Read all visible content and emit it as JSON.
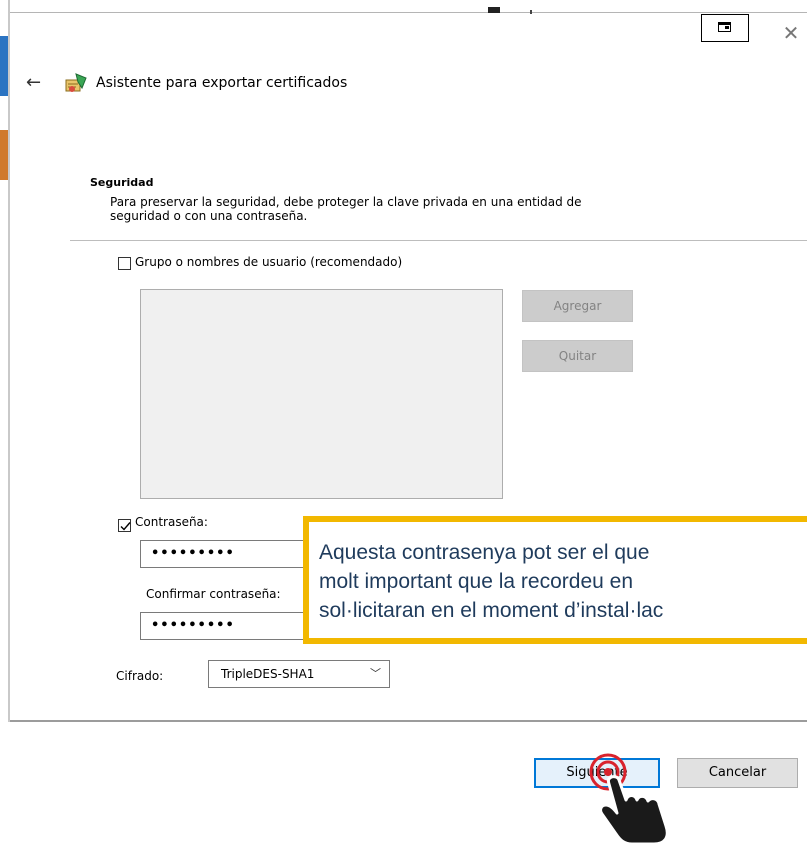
{
  "window": {
    "title": "Asistente para exportar certificados"
  },
  "security": {
    "section_title": "Seguridad",
    "description_line1": "Para preservar la seguridad, debe proteger la clave privada en una entidad de",
    "description_line2": "seguridad o con una contraseña.",
    "group_checkbox_label": "Grupo o nombres de usuario (recomendado)",
    "group_checked": false,
    "add_button": "Agregar",
    "remove_button": "Quitar",
    "password_checkbox_label": "Contraseña:",
    "password_checked": true,
    "password_value": "•••••••••",
    "confirm_label": "Confirmar contraseña:",
    "confirm_value": "•••••••••",
    "encryption_label": "Cifrado:",
    "encryption_value": "TripleDES-SHA1"
  },
  "footer": {
    "next_button": "Siguiente",
    "cancel_button": "Cancelar"
  },
  "callout": {
    "line1": "Aquesta contrasenya pot ser el que",
    "line2": "molt important que la recordeu en",
    "line3": "sol·licitaran en el moment d’instal·lac"
  },
  "colors": {
    "accent_blue": "#0078d7",
    "callout_border": "#f2b800",
    "callout_text": "#1f3b5c",
    "click_ring": "#d9232d"
  }
}
